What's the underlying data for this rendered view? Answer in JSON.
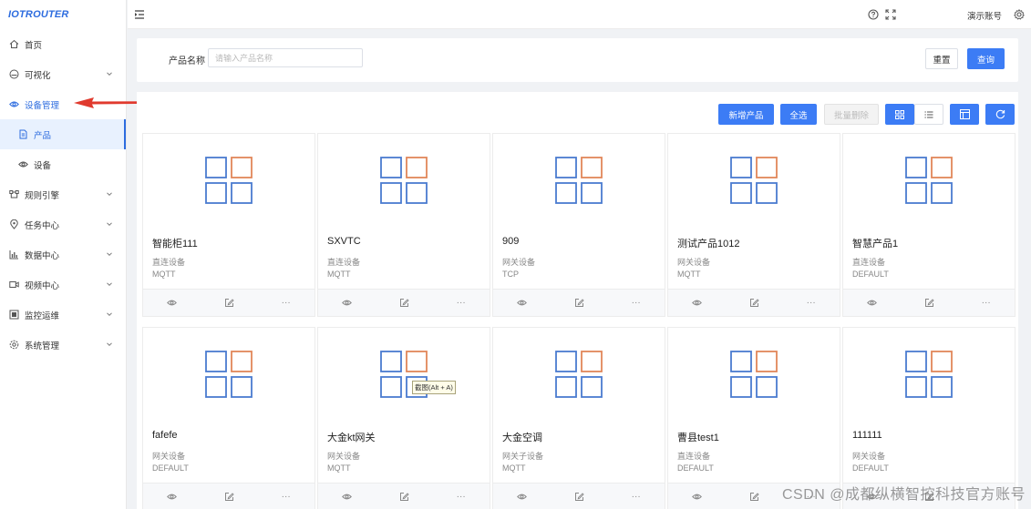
{
  "logo": {
    "text": "IOTROUTER"
  },
  "sidebar": {
    "items": [
      {
        "label": "首页",
        "icon": "home-icon",
        "chevron": false
      },
      {
        "label": "可视化",
        "icon": "dashboard-icon",
        "chevron": true
      },
      {
        "label": "设备管理",
        "icon": "eye-icon",
        "chevron": false,
        "active": true
      },
      {
        "label": "产品",
        "icon": "document-icon",
        "sub": true,
        "selected": true
      },
      {
        "label": "设备",
        "icon": "eye-icon",
        "sub": true
      },
      {
        "label": "规则引擎",
        "icon": "rule-icon",
        "chevron": true
      },
      {
        "label": "任务中心",
        "icon": "pin-icon",
        "chevron": true
      },
      {
        "label": "数据中心",
        "icon": "bar-chart-icon",
        "chevron": true
      },
      {
        "label": "视频中心",
        "icon": "video-icon",
        "chevron": true
      },
      {
        "label": "监控运维",
        "icon": "monitor-icon",
        "chevron": true
      },
      {
        "label": "系统管理",
        "icon": "gear-icon",
        "chevron": true
      }
    ]
  },
  "header": {
    "user": "演示账号"
  },
  "search": {
    "label": "产品名称",
    "placeholder": "请输入产品名称",
    "value": "",
    "reset_label": "重置",
    "query_label": "查询"
  },
  "toolbar": {
    "add_label": "新增产品",
    "select_all_label": "全选",
    "batch_delete_label": "批量删除"
  },
  "colors": {
    "primary": "#3c7cf5",
    "thumb_blue": "#4a7bd0",
    "thumb_orange": "#e2875a",
    "arrow_red": "#e03a2e"
  },
  "cards": [
    {
      "name": "智能柜111",
      "type": "直连设备",
      "protocol": "MQTT"
    },
    {
      "name": "SXVTC",
      "type": "直连设备",
      "protocol": "MQTT"
    },
    {
      "name": "909",
      "type": "网关设备",
      "protocol": "TCP"
    },
    {
      "name": "测试产品1012",
      "type": "网关设备",
      "protocol": "MQTT"
    },
    {
      "name": "智慧产品1",
      "type": "直连设备",
      "protocol": "DEFAULT"
    },
    {
      "name": "fafefe",
      "type": "网关设备",
      "protocol": "DEFAULT"
    },
    {
      "name": "大金kt网关",
      "type": "网关设备",
      "protocol": "MQTT"
    },
    {
      "name": "大金空调",
      "type": "网关子设备",
      "protocol": "MQTT"
    },
    {
      "name": "曹县test1",
      "type": "直连设备",
      "protocol": "DEFAULT"
    },
    {
      "name": "111111",
      "type": "网关设备",
      "protocol": "DEFAULT"
    }
  ],
  "card_actions": {
    "more": "···"
  },
  "tooltip": "截图(Alt + A)",
  "watermark": "CSDN @成都纵横智控科技官方账号"
}
